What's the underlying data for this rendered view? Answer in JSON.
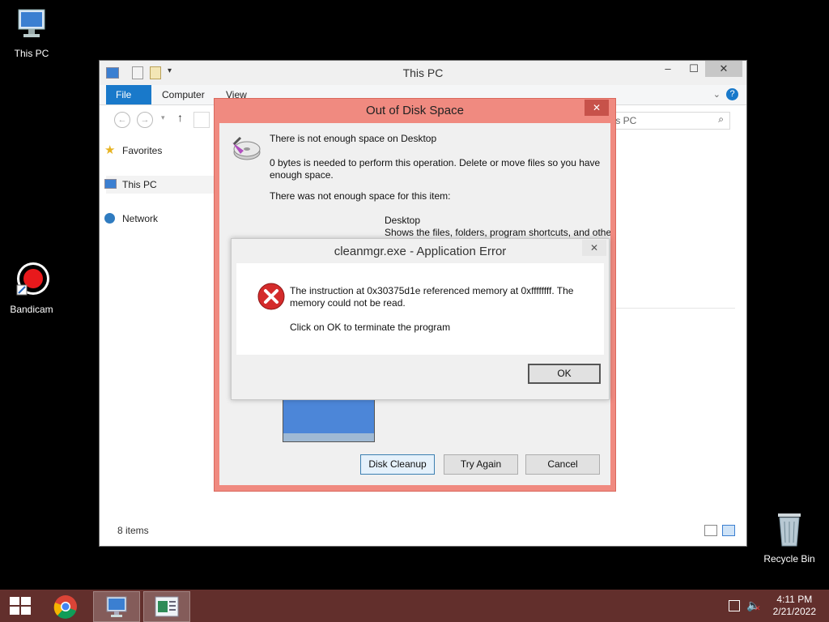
{
  "desktop": {
    "icons": [
      {
        "label": "This PC"
      },
      {
        "label": "Bandicam"
      },
      {
        "label": "Recycle Bin"
      }
    ]
  },
  "explorer": {
    "title": "This PC",
    "tabs": [
      "File",
      "Computer",
      "View"
    ],
    "search_placeholder": "his PC",
    "nav": [
      "Favorites",
      "This PC",
      "Network"
    ],
    "status": "8 items"
  },
  "disk_dialog": {
    "title": "Out of Disk Space",
    "heading": "There is not enough space on Desktop",
    "message": "0 bytes is needed to perform this operation. Delete or move files so you have enough space.",
    "item_intro": "There was not enough space for this item:",
    "item_name": "Desktop",
    "item_desc": "Shows the files, folders, program shortcuts, and othe",
    "buttons": [
      "Disk Cleanup",
      "Try Again",
      "Cancel"
    ]
  },
  "error_dialog": {
    "title": "cleanmgr.exe - Application Error",
    "message1": "The instruction at 0x30375d1e referenced memory at 0xffffffff. The memory could not be read.",
    "message2": "Click on OK to terminate the program",
    "ok_label": "OK"
  },
  "taskbar": {
    "time": "4:11 PM",
    "date": "2/21/2022"
  },
  "colors": {
    "accent": "#1979ca",
    "dialog_border": "#f08a80",
    "taskbar": "#622f2c"
  }
}
